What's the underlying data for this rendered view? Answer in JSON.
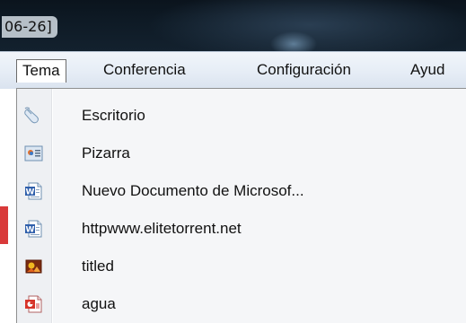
{
  "window": {
    "title_fragment": "06-26]"
  },
  "menubar": {
    "items": [
      {
        "label": "Tema",
        "active": true
      },
      {
        "label": "Conferencia",
        "active": false
      },
      {
        "label": "Configuración",
        "active": false
      },
      {
        "label": "Ayud",
        "active": false
      }
    ]
  },
  "dropdown": {
    "items": [
      {
        "label": "Escritorio",
        "icon": "mouse-icon"
      },
      {
        "label": "Pizarra",
        "icon": "whiteboard-icon"
      },
      {
        "label": "Nuevo Documento de Microsof...",
        "icon": "word-document-icon"
      },
      {
        "label": "httpwww.elitetorrent.net",
        "icon": "word-document-icon"
      },
      {
        "label": "titled",
        "icon": "image-file-icon"
      },
      {
        "label": "agua",
        "icon": "presentation-file-icon"
      }
    ]
  },
  "colors": {
    "titlebar": "#0e1a25",
    "menubar": "#e6edf6",
    "dropdown_bg": "#f5f6f8",
    "dropdown_border": "#8e8f8f"
  }
}
